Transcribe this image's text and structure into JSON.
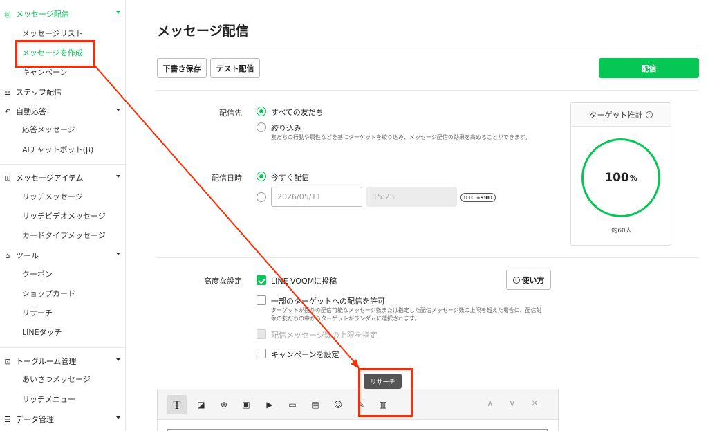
{
  "sidebar": {
    "groups": [
      {
        "label": "メッセージ配信",
        "icon": "broadcast-icon",
        "items": [
          "メッセージリスト",
          "メッセージを作成",
          "キャンペーン"
        ]
      },
      {
        "label": "ステップ配信",
        "icon": "step-icon"
      },
      {
        "label": "自動応答",
        "icon": "reply-icon",
        "items": [
          "応答メッセージ",
          "AIチャットボット(β)"
        ]
      },
      {
        "label": "メッセージアイテム",
        "icon": "message-item-icon",
        "items": [
          "リッチメッセージ",
          "リッチビデオメッセージ",
          "カードタイプメッセージ"
        ]
      },
      {
        "label": "ツール",
        "icon": "shop-icon",
        "items": [
          "クーポン",
          "ショップカード",
          "リサーチ",
          "LINEタッチ"
        ]
      },
      {
        "label": "トークルーム管理",
        "icon": "talkroom-icon",
        "items": [
          "あいさつメッセージ",
          "リッチメニュー"
        ]
      },
      {
        "label": "データ管理",
        "icon": "database-icon"
      }
    ]
  },
  "main": {
    "title": "メッセージ配信",
    "buttons": {
      "draft": "下書き保存",
      "test": "テスト配信",
      "send": "配信"
    },
    "target": {
      "label": "配信先",
      "options": [
        "すべての友だち",
        "絞り込み"
      ],
      "help": "友だちの行動や属性などを基にターゲットを絞り込み、メッセージ配信の効果を高めることができます。"
    },
    "schedule": {
      "label": "配信日時",
      "now": "今すぐ配信",
      "date": "2026/05/11",
      "time": "15:25",
      "tz": "UTC +9:00"
    },
    "estimate": {
      "title": "ターゲット推計",
      "help_glyph": "?",
      "percent_num": "100",
      "percent_unit": "%",
      "count": "約60人"
    },
    "advanced": {
      "label": "高度な設定",
      "howto_glyph": "i",
      "howto": "使い方",
      "voom": "LINE VOOMに投稿",
      "partial": "一部のターゲットへの配信を許可",
      "partial_help": "ターゲットが残りの配信可能なメッセージ数または指定した配信メッセージ数の上限を超えた場合に、配信対象の友だちの中からターゲットがランダムに選択されます。",
      "limit": "配信メッセージ数の上限を指定",
      "campaign": "キャンペーンを設定"
    },
    "editor": {
      "tooltip": "リサーチ",
      "text_tool": "T",
      "tool_glyphs": [
        "◪",
        "⊕",
        "▣",
        "▶",
        "▭",
        "▤",
        "☺",
        "✎",
        "▥"
      ],
      "nav": [
        "∧",
        "∨",
        "✕"
      ]
    }
  },
  "colors": {
    "accent": "#06c755",
    "highlight": "#ff2a00"
  }
}
